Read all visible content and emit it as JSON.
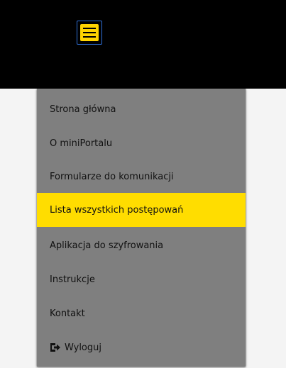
{
  "header": {
    "menu_toggle_icon": "hamburger-menu-icon",
    "colors": {
      "background": "#000000",
      "accent": "#ffd400",
      "focus_outline": "#2f6fd6"
    }
  },
  "menu": {
    "colors": {
      "background": "#7f7f7f",
      "active": "#ffdd00",
      "text": "#111111"
    },
    "items": [
      {
        "label": "Strona główna",
        "active": false
      },
      {
        "label": "O miniPortalu",
        "active": false
      },
      {
        "label": "Formularze do komunikacji",
        "active": false
      },
      {
        "label": "Lista wszystkich postępowań",
        "active": true
      },
      {
        "label": "Aplikacja do szyfrowania",
        "active": false
      },
      {
        "label": "Instrukcje",
        "active": false
      },
      {
        "label": "Kontakt",
        "active": false
      },
      {
        "label": "Wyloguj",
        "active": false,
        "icon": "sign-out-icon"
      }
    ]
  }
}
